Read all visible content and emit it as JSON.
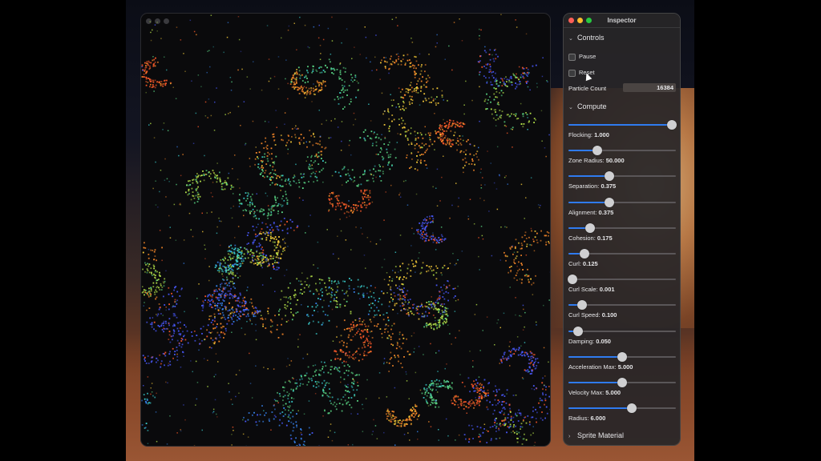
{
  "inspector": {
    "title": "Inspector",
    "sections": {
      "controls": "Controls",
      "compute": "Compute",
      "sprite_material": "Sprite Material"
    },
    "pause_label": "Pause",
    "reset_label": "Reset",
    "particle_count_label": "Particle Count",
    "particle_count_value": "16384",
    "sliders": [
      {
        "label": "Flocking:",
        "value": "1.000",
        "fraction": 0.96
      },
      {
        "label": "Zone Radius:",
        "value": "50.000",
        "fraction": 0.27
      },
      {
        "label": "Separation:",
        "value": "0.375",
        "fraction": 0.38
      },
      {
        "label": "Alignment:",
        "value": "0.375",
        "fraction": 0.38
      },
      {
        "label": "Cohesion:",
        "value": "0.175",
        "fraction": 0.2
      },
      {
        "label": "Curl:",
        "value": "0.125",
        "fraction": 0.15
      },
      {
        "label": "Curl Scale:",
        "value": "0.001",
        "fraction": 0.04
      },
      {
        "label": "Curl Speed:",
        "value": "0.100",
        "fraction": 0.13
      },
      {
        "label": "Damping:",
        "value": "0.050",
        "fraction": 0.09
      },
      {
        "label": "Acceleration Max:",
        "value": "5.000",
        "fraction": 0.5
      },
      {
        "label": "Velocity Max:",
        "value": "5.000",
        "fraction": 0.5
      },
      {
        "label": "Radius:",
        "value": "6.000",
        "fraction": 0.59
      }
    ]
  },
  "colors": {
    "accent": "#2f7bf0",
    "traffic_close": "#fe5f57",
    "traffic_min": "#febc2e",
    "traffic_max": "#28c840"
  },
  "particles": {
    "palette": [
      "#ff5a2a",
      "#ff8c2a",
      "#ffd23a",
      "#b8e64a",
      "#5ee08a",
      "#3ad0d0",
      "#3a8cff",
      "#4a5aff"
    ]
  }
}
